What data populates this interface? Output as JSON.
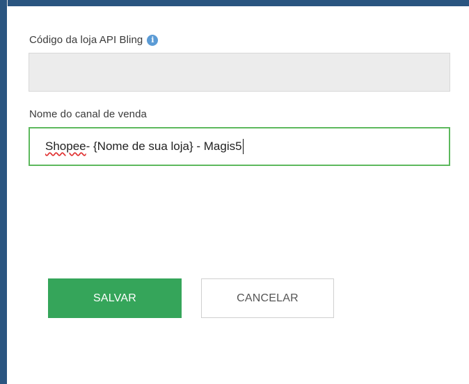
{
  "form": {
    "store_code_label": "Código da loja API Bling",
    "store_code_value": "",
    "channel_name_label": "Nome do canal de venda",
    "channel_name_value_word1": "Shopee",
    "channel_name_value_rest": "- {Nome de sua loja} - Magis5"
  },
  "actions": {
    "save_label": "SALVAR",
    "cancel_label": "CANCELAR"
  },
  "icons": {
    "info": "info-icon"
  },
  "colors": {
    "background": "#2a5580",
    "save_button": "#35a55a",
    "active_border": "#5cb85c",
    "info_icon": "#5b9bd5"
  }
}
